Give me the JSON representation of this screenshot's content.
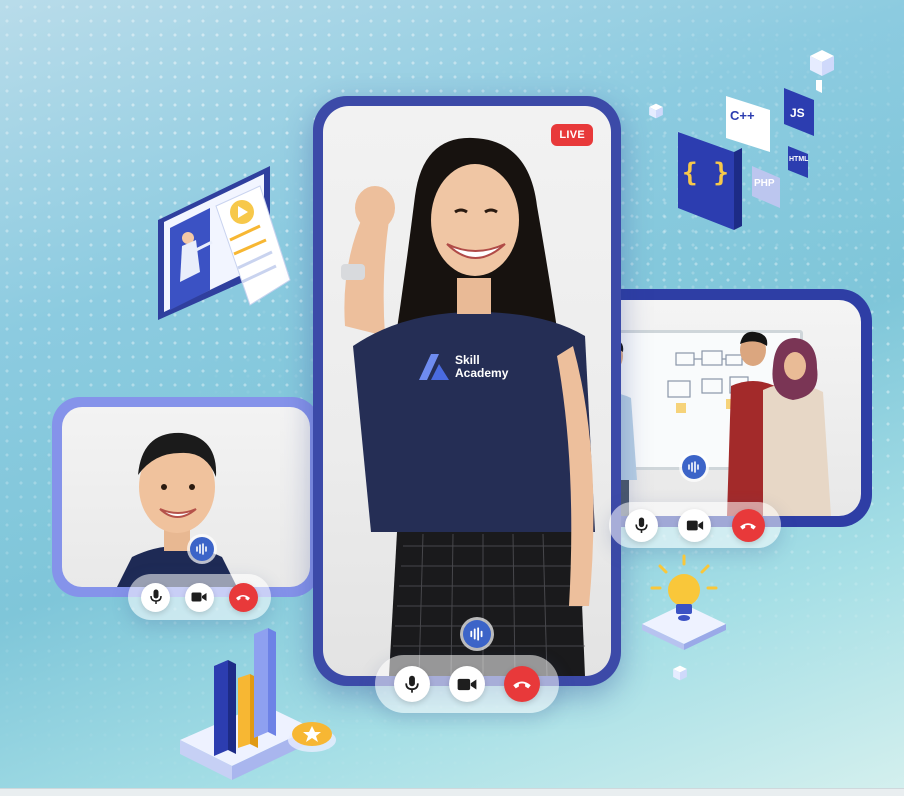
{
  "main_call": {
    "live_label": "LIVE",
    "shirt_brand_line1": "Skill",
    "shirt_brand_line2": "Academy",
    "controls": [
      "microphone-icon",
      "video-camera-icon",
      "end-call-icon"
    ]
  },
  "left_call": {
    "controls": [
      "microphone-icon",
      "video-camera-icon",
      "end-call-icon"
    ]
  },
  "right_call": {
    "controls": [
      "microphone-icon",
      "video-camera-icon",
      "end-call-icon"
    ]
  },
  "code_badges": {
    "cpp": "C++",
    "js": "JS",
    "html": "HTML",
    "php": "PHP",
    "braces": "{ }"
  },
  "colors": {
    "frame_main": "#3c4aa8",
    "frame_left": "#8593ea",
    "frame_right": "#2e3ea5",
    "end_call": "#e8393a",
    "audio_indicator": "#3c64c8"
  }
}
